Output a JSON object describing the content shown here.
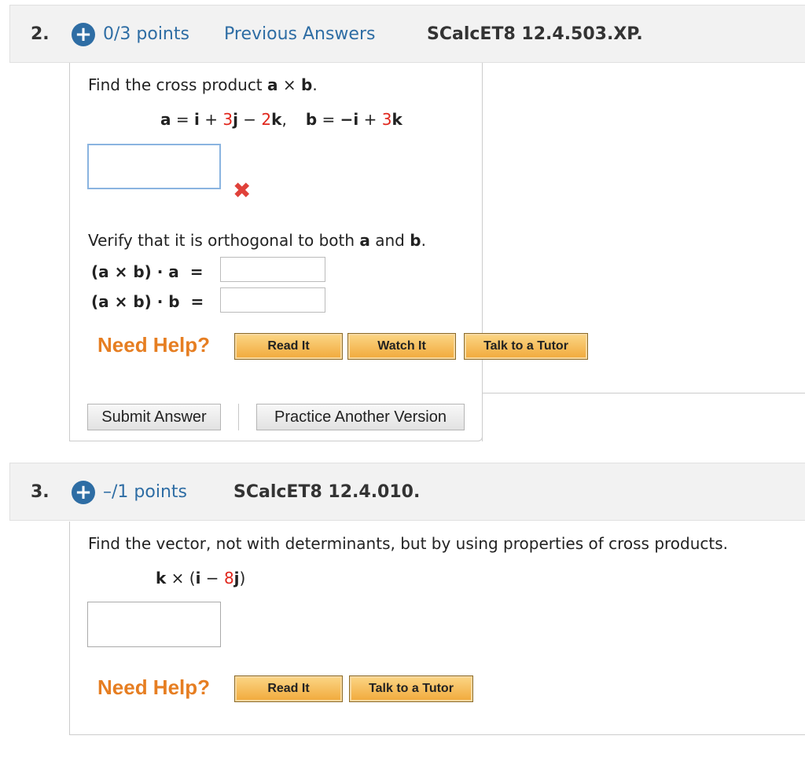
{
  "q2": {
    "number": "2.",
    "points": "0/3 points",
    "previous_answers": "Previous Answers",
    "code": "SCalcET8 12.4.503.XP.",
    "prompt_pre": "Find the cross product ",
    "prompt_a": "a",
    "prompt_times": " × ",
    "prompt_b": "b",
    "prompt_end": ".",
    "eq": {
      "a1": "a",
      "a2": " = ",
      "a3": "i",
      "a4": " + ",
      "a5": "3",
      "a6": "j",
      "a7": " − ",
      "a8": "2",
      "a9": "k",
      "a10": ",",
      "b1": "b",
      "b2": " = ",
      "b3": "−i",
      "b4": " + ",
      "b5": "3",
      "b6": "k"
    },
    "answer_value": "",
    "wrong_mark": "✖",
    "verify_pre": "Verify that it is orthogonal to both ",
    "verify_a": "a",
    "verify_and": " and ",
    "verify_b": "b",
    "verify_end": ".",
    "dot_a_label": "(a × b) · a  =",
    "dot_b_label": "(a × b) · b  =",
    "need_help": "Need Help?",
    "btn_read": "Read It",
    "btn_watch": "Watch It",
    "btn_tutor": "Talk to a Tutor",
    "submit": "Submit Answer",
    "practice": "Practice Another Version"
  },
  "q3": {
    "number": "3.",
    "points": "–/1 points",
    "code": "SCalcET8 12.4.010.",
    "prompt": "Find the vector, not with determinants, but by using properties of cross products.",
    "expr": {
      "k": "k",
      "times": " × (",
      "i": "i",
      "minus": " − ",
      "coef": "8",
      "j": "j",
      "close": ")"
    },
    "need_help": "Need Help?",
    "btn_read": "Read It",
    "btn_tutor": "Talk to a Tutor"
  },
  "colors": {
    "link_blue": "#2e6da4",
    "help_orange": "#e67e22",
    "error_red": "#e0413a"
  }
}
